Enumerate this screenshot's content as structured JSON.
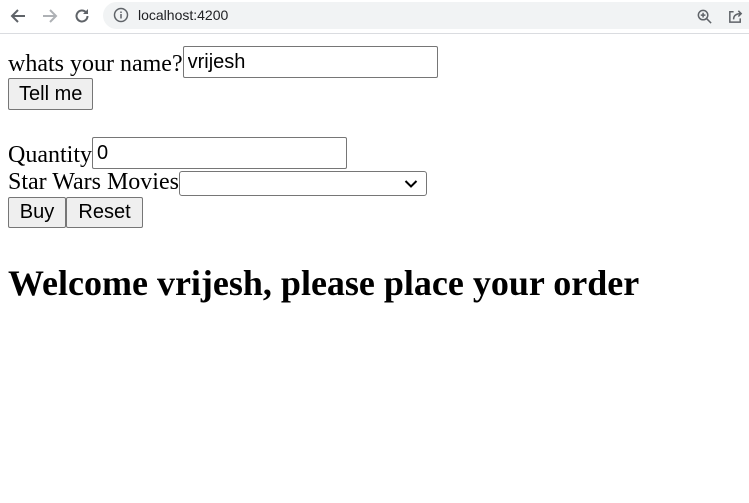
{
  "browser": {
    "url": "localhost:4200",
    "icons": [
      "back-arrow-icon",
      "forward-arrow-icon",
      "reload-icon",
      "info-icon",
      "zoom-icon",
      "share-icon"
    ]
  },
  "form": {
    "name_label": "whats your name?",
    "name_value": "vrijesh",
    "tell_me_label": "Tell me",
    "quantity_label": "Quantity",
    "quantity_value": "0",
    "movies_label": "Star Wars Movies",
    "movies_selected": "",
    "buy_label": "Buy",
    "reset_label": "Reset"
  },
  "welcome": "Welcome vrijesh, please place your order"
}
